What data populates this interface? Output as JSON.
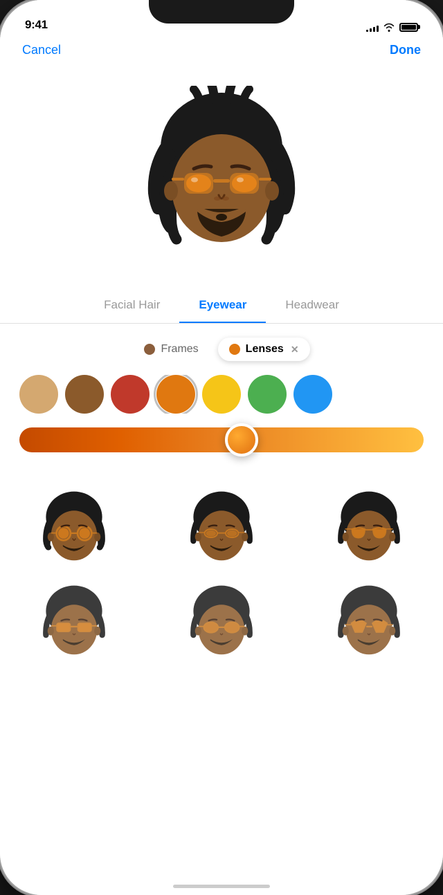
{
  "statusBar": {
    "time": "9:41",
    "signalBars": [
      3,
      5,
      7,
      9,
      11
    ],
    "batteryLevel": 100
  },
  "nav": {
    "cancel": "Cancel",
    "done": "Done"
  },
  "tabs": [
    {
      "id": "facial-hair",
      "label": "Facial Hair",
      "active": false
    },
    {
      "id": "eyewear",
      "label": "Eyewear",
      "active": true
    },
    {
      "id": "headwear",
      "label": "Headwear",
      "active": false
    }
  ],
  "filters": [
    {
      "id": "frames",
      "label": "Frames",
      "active": false,
      "color": "#8B5E3C"
    },
    {
      "id": "lenses",
      "label": "Lenses",
      "active": true,
      "color": "#E07810",
      "hasClose": true
    }
  ],
  "swatches": [
    {
      "id": "swatch-tan",
      "color": "#D4A870",
      "selected": false
    },
    {
      "id": "swatch-brown",
      "color": "#8B5A2B",
      "selected": false
    },
    {
      "id": "swatch-red",
      "color": "#C0392B",
      "selected": false
    },
    {
      "id": "swatch-orange",
      "color": "#E07810",
      "selected": true
    },
    {
      "id": "swatch-yellow",
      "color": "#F5C518",
      "selected": false
    },
    {
      "id": "swatch-green",
      "color": "#4CAF50",
      "selected": false
    },
    {
      "id": "swatch-blue",
      "color": "#2196F3",
      "selected": false
    }
  ],
  "slider": {
    "value": 55,
    "gradientStart": "#c44a00",
    "gradientEnd": "#ffc040"
  },
  "avatarGrid": [
    {
      "id": "av1",
      "emoji": "🧔🏾"
    },
    {
      "id": "av2",
      "emoji": "🧔🏾"
    },
    {
      "id": "av3",
      "emoji": "🧔🏾"
    },
    {
      "id": "av4",
      "emoji": "🧔🏾"
    },
    {
      "id": "av5",
      "emoji": "🧔🏾"
    },
    {
      "id": "av6",
      "emoji": "🧔🏾"
    }
  ],
  "mainAvatar": {
    "emoji": "🧔🏾"
  }
}
